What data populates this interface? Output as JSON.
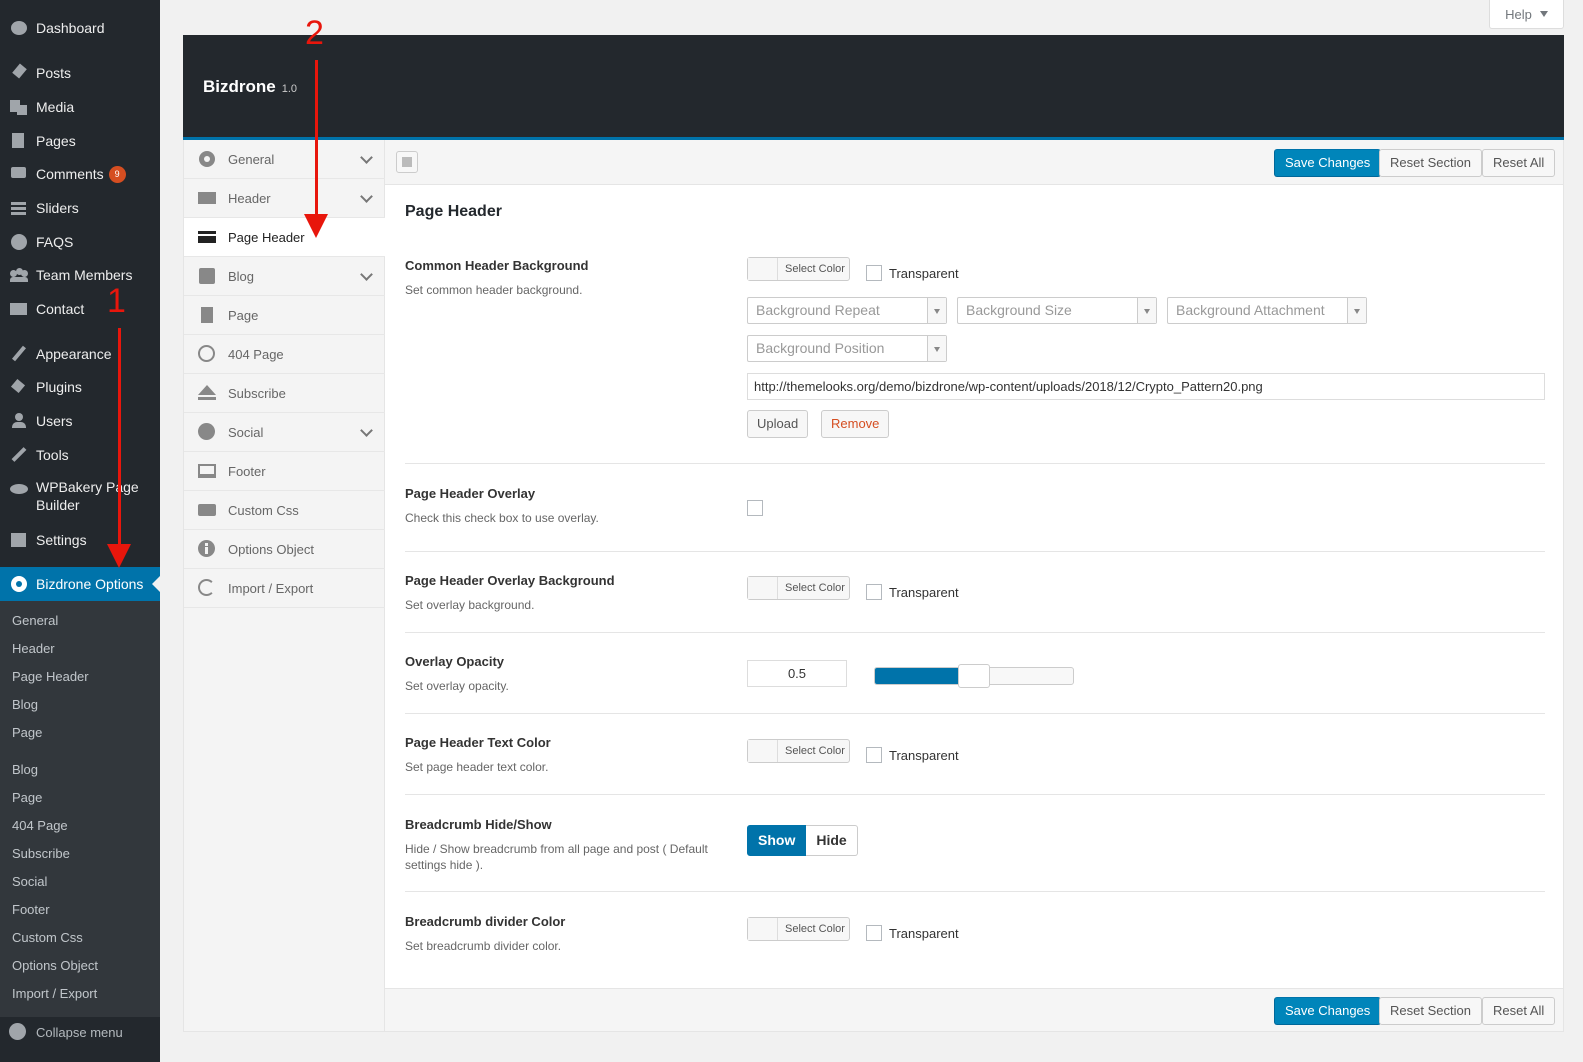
{
  "admin_menu": {
    "items": [
      {
        "label": "Dashboard",
        "icon": "dashboard-icon"
      },
      {
        "label": "Posts",
        "icon": "pin-icon"
      },
      {
        "label": "Media",
        "icon": "media-icon"
      },
      {
        "label": "Pages",
        "icon": "pages-icon"
      },
      {
        "label": "Comments",
        "icon": "comment-icon",
        "badge": "9"
      },
      {
        "label": "Sliders",
        "icon": "list-icon"
      },
      {
        "label": "FAQS",
        "icon": "question-icon"
      },
      {
        "label": "Team Members",
        "icon": "groups-icon"
      },
      {
        "label": "Contact",
        "icon": "email-icon"
      },
      {
        "label": "Appearance",
        "icon": "brush-icon"
      },
      {
        "label": "Plugins",
        "icon": "plugin-icon"
      },
      {
        "label": "Users",
        "icon": "user-icon"
      },
      {
        "label": "Tools",
        "icon": "wrench-icon"
      },
      {
        "label": "WPBakery Page Builder",
        "icon": "cloud-icon"
      },
      {
        "label": "Settings",
        "icon": "settings-icon"
      },
      {
        "label": "Bizdrone Options",
        "icon": "gear-icon"
      }
    ],
    "submenu": [
      "General",
      "Header",
      "Page Header",
      "Blog",
      "Page",
      "Blog",
      "Page",
      "404 Page",
      "Subscribe",
      "Social",
      "Footer",
      "Custom Css",
      "Options Object",
      "Import / Export"
    ],
    "collapse_label": "Collapse menu"
  },
  "help_tab": {
    "label": "Help"
  },
  "panel": {
    "title": "Bizdrone",
    "version": "1.0",
    "nav": [
      {
        "label": "General",
        "icon": "gear-icon",
        "has_children": true
      },
      {
        "label": "Header",
        "icon": "header-icon",
        "has_children": true
      },
      {
        "label": "Page Header",
        "icon": "card-icon",
        "active": true
      },
      {
        "label": "Blog",
        "icon": "blog-icon",
        "has_children": true
      },
      {
        "label": "Page",
        "icon": "page-icon"
      },
      {
        "label": "404 Page",
        "icon": "block-icon"
      },
      {
        "label": "Subscribe",
        "icon": "eject-icon"
      },
      {
        "label": "Social",
        "icon": "globe-icon",
        "has_children": true
      },
      {
        "label": "Footer",
        "icon": "footer-icon"
      },
      {
        "label": "Custom Css",
        "icon": "css-icon"
      },
      {
        "label": "Options Object",
        "icon": "info-icon"
      },
      {
        "label": "Import / Export",
        "icon": "refresh-icon"
      }
    ],
    "buttons": {
      "save": "Save Changes",
      "reset_section": "Reset Section",
      "reset_all": "Reset All"
    }
  },
  "section": {
    "title": "Page Header",
    "fields": {
      "common_bg": {
        "title": "Common Header Background",
        "desc": "Set common header background.",
        "select_color": "Select Color",
        "transparent": "Transparent",
        "repeat_placeholder": "Background Repeat",
        "size_placeholder": "Background Size",
        "attachment_placeholder": "Background Attachment",
        "position_placeholder": "Background Position",
        "url": "http://themelooks.org/demo/bizdrone/wp-content/uploads/2018/12/Crypto_Pattern20.png",
        "upload": "Upload",
        "remove": "Remove"
      },
      "overlay": {
        "title": "Page Header Overlay",
        "desc": "Check this check box to use overlay.",
        "checked": false
      },
      "overlay_bg": {
        "title": "Page Header Overlay Background",
        "desc": "Set overlay background.",
        "select_color": "Select Color",
        "transparent": "Transparent"
      },
      "opacity": {
        "title": "Overlay Opacity",
        "desc": "Set overlay opacity.",
        "value": "0.5",
        "slider_fraction": 0.5
      },
      "text_color": {
        "title": "Page Header Text Color",
        "desc": "Set page header text color.",
        "select_color": "Select Color",
        "transparent": "Transparent"
      },
      "breadcrumb": {
        "title": "Breadcrumb Hide/Show",
        "desc": "Hide / Show breadcrumb from all page and post ( Default settings hide ).",
        "show": "Show",
        "hide": "Hide",
        "selected": "Show"
      },
      "divider_color": {
        "title": "Breadcrumb divider Color",
        "desc": "Set breadcrumb divider color.",
        "select_color": "Select Color",
        "transparent": "Transparent"
      }
    }
  },
  "annotations": {
    "one": "1",
    "two": "2"
  },
  "colors": {
    "accent": "#0073aa",
    "sidebar": "#23282d",
    "annotation": "#e8160c"
  }
}
